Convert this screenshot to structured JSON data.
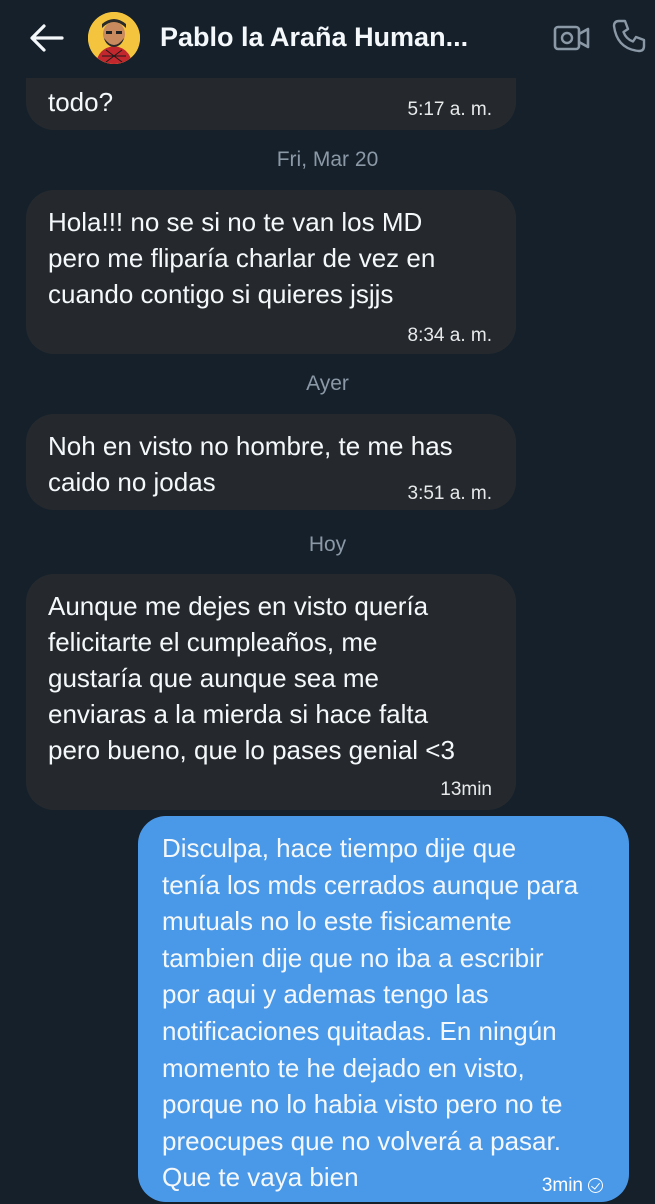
{
  "header": {
    "contact_name": "Pablo la Araña Human..."
  },
  "messages": [
    {
      "direction": "in",
      "text": "todo?",
      "time": "5:17 a. m."
    },
    {
      "separator": "Fri, Mar 20"
    },
    {
      "direction": "in",
      "text": "Hola!!! no se si no te van los MD\npero me fliparía charlar de vez en\ncuando contigo si quieres jsjjs",
      "time": "8:34 a. m."
    },
    {
      "separator": "Ayer"
    },
    {
      "direction": "in",
      "text": "Noh en visto no hombre, te me has\ncaido no jodas",
      "time": "3:51 a. m."
    },
    {
      "separator": "Hoy"
    },
    {
      "direction": "in",
      "text": "Aunque me dejes en visto quería\nfelicitarte el cumpleaños, me\ngustaría que aunque sea me\nenviaras a la mierda si hace falta\npero bueno, que lo pases genial <3",
      "time": "13min"
    },
    {
      "direction": "out",
      "text": "Disculpa, hace tiempo dije que\ntenía los mds cerrados aunque para\nmutuals no lo este fisicamente\ntambien dije que no iba a escribir\npor aqui y ademas tengo las\nnotificaciones quitadas.  En ningún\nmomento te he dejado en visto,\nporque no lo habia visto pero no te\npreocupes que no volverá a pasar.\nQue te vaya bien",
      "time": "3min"
    }
  ],
  "colors": {
    "background": "#15202b",
    "incoming_bubble": "#25292d",
    "outgoing_bubble": "#4a99e9",
    "separator_text": "#8b98a5"
  },
  "icons": [
    "back-arrow-icon",
    "video-call-icon",
    "phone-icon",
    "read-check-icon"
  ]
}
